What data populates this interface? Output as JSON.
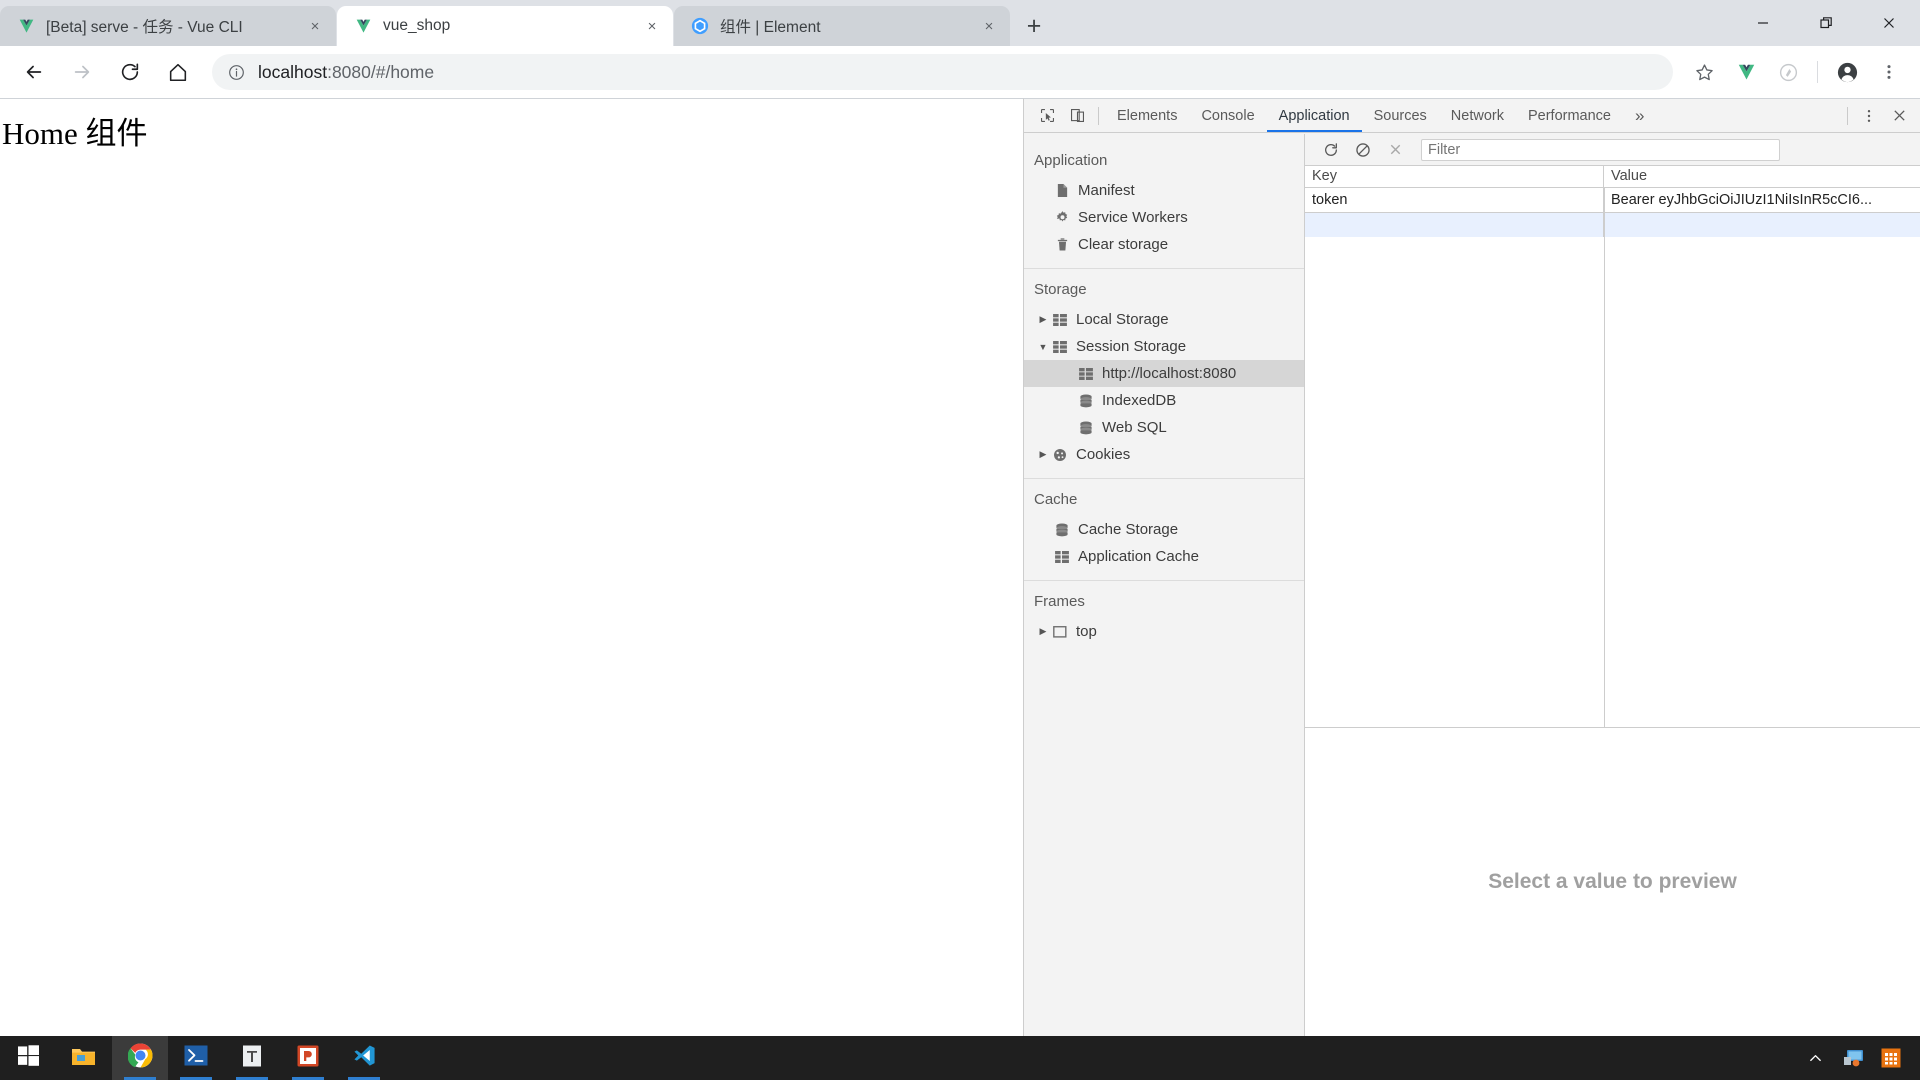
{
  "window": {
    "controls": [
      {
        "name": "minimize",
        "glyph": "minimize-icon"
      },
      {
        "name": "restore",
        "glyph": "restore-icon"
      },
      {
        "name": "close",
        "glyph": "close-icon"
      }
    ]
  },
  "tabs": [
    {
      "title": "[Beta] serve - 任务 - Vue CLI",
      "favicon": "vue-icon",
      "active": false,
      "close_label": "×"
    },
    {
      "title": "vue_shop",
      "favicon": "vue-icon",
      "active": true,
      "close_label": "×"
    },
    {
      "title": "组件 | Element",
      "favicon": "element-icon",
      "active": false,
      "close_label": "×"
    }
  ],
  "newtab_label": "+",
  "toolbar": {
    "back_icon": "back-arrow-icon",
    "forward_icon": "forward-arrow-icon",
    "reload_icon": "reload-icon",
    "home_icon": "home-icon",
    "info_icon": "info-circle-icon",
    "url_strong": "localhost",
    "url_rest": ":8080/#/home",
    "url_full": "localhost:8080/#/home",
    "bookmark_icon": "star-icon",
    "vue_devtools_icon": "vue-extension-icon",
    "extension_icon": "extension-circle-icon",
    "profile_icon": "profile-avatar-icon",
    "menu_icon": "kebab-menu-icon"
  },
  "page": {
    "heading": "Home 组件"
  },
  "devtools": {
    "inspect_icon": "inspect-element-icon",
    "device_icon": "device-toolbar-icon",
    "tabs": [
      {
        "label": "Elements",
        "active": false
      },
      {
        "label": "Console",
        "active": false
      },
      {
        "label": "Application",
        "active": true
      },
      {
        "label": "Sources",
        "active": false
      },
      {
        "label": "Network",
        "active": false
      },
      {
        "label": "Performance",
        "active": false
      }
    ],
    "overflow_label": "»",
    "more_icon": "kebab-menu-icon",
    "close_icon": "close-icon",
    "accent_color": "#1a73e8",
    "sidebar": [
      {
        "title": "Application",
        "items": [
          {
            "label": "Manifest",
            "icon": "manifest-document-icon",
            "arrow": "",
            "selected": false,
            "indent": false
          },
          {
            "label": "Service Workers",
            "icon": "gear-icon",
            "arrow": "",
            "selected": false,
            "indent": false
          },
          {
            "label": "Clear storage",
            "icon": "trash-icon",
            "arrow": "",
            "selected": false,
            "indent": false
          }
        ]
      },
      {
        "title": "Storage",
        "items": [
          {
            "label": "Local Storage",
            "icon": "table-grid-icon",
            "arrow": "▶",
            "selected": false,
            "indent": false
          },
          {
            "label": "Session Storage",
            "icon": "table-grid-icon",
            "arrow": "▼",
            "selected": false,
            "indent": false
          },
          {
            "label": "http://localhost:8080",
            "icon": "table-grid-icon",
            "arrow": "",
            "selected": true,
            "indent": true
          },
          {
            "label": "IndexedDB",
            "icon": "database-icon",
            "arrow": "",
            "selected": false,
            "indent": false
          },
          {
            "label": "Web SQL",
            "icon": "database-icon",
            "arrow": "",
            "selected": false,
            "indent": false
          },
          {
            "label": "Cookies",
            "icon": "cookie-icon",
            "arrow": "▶",
            "selected": false,
            "indent": false
          }
        ]
      },
      {
        "title": "Cache",
        "items": [
          {
            "label": "Cache Storage",
            "icon": "database-icon",
            "arrow": "",
            "selected": false,
            "indent": false
          },
          {
            "label": "Application Cache",
            "icon": "table-grid-icon",
            "arrow": "",
            "selected": false,
            "indent": false
          }
        ]
      },
      {
        "title": "Frames",
        "items": [
          {
            "label": "top",
            "icon": "frame-square-icon",
            "arrow": "▶",
            "selected": false,
            "indent": false
          }
        ]
      }
    ],
    "filterbar": {
      "refresh_icon": "refresh-icon",
      "clear_icon": "clear-all-icon",
      "delete_icon": "delete-selected-icon",
      "filter_placeholder": "Filter",
      "filter_value": ""
    },
    "table": {
      "columns": [
        "Key",
        "Value"
      ],
      "rows": [
        {
          "key": "token",
          "value": "Bearer eyJhbGciOiJIUzI1NiIsInR5cCI6..."
        }
      ]
    },
    "preview_placeholder": "Select a value to preview"
  },
  "taskbar": {
    "items": [
      {
        "name": "start-button",
        "icon": "windows-logo-icon",
        "active": false,
        "running": false
      },
      {
        "name": "file-explorer",
        "icon": "folder-icon",
        "active": false,
        "running": false
      },
      {
        "name": "google-chrome",
        "icon": "chrome-icon",
        "active": true,
        "running": true
      },
      {
        "name": "powershell",
        "icon": "powershell-icon",
        "active": false,
        "running": true
      },
      {
        "name": "typora",
        "icon": "typora-icon",
        "active": false,
        "running": true
      },
      {
        "name": "powerpoint",
        "icon": "powerpoint-icon",
        "active": false,
        "running": true
      },
      {
        "name": "vs-code",
        "icon": "vscode-icon",
        "active": false,
        "running": true
      }
    ],
    "tray": [
      {
        "name": "show-hidden-icons",
        "icon": "chevron-up-icon"
      },
      {
        "name": "network-icon",
        "icon": "network-monitor-icon"
      },
      {
        "name": "tray-app-icon",
        "icon": "orange-app-icon"
      }
    ]
  }
}
